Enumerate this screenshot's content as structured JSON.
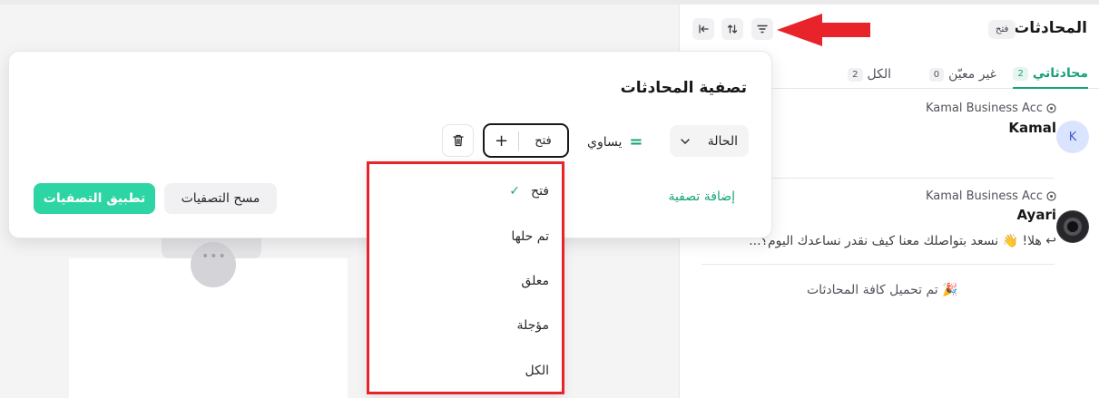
{
  "sidebar": {
    "title": "المحادثات",
    "status_pill": "فتح",
    "icons": [
      "filter-icon",
      "sort-icon",
      "collapse-icon"
    ],
    "tabs": [
      {
        "label": "محادثاتي",
        "count": "2"
      },
      {
        "label": "غير معيّن",
        "count": "0"
      },
      {
        "label": "الكل",
        "count": "2"
      }
    ],
    "conversations": [
      {
        "inbox": "Kamal Business Acc",
        "name": "Kamal",
        "avatar": "K",
        "message": ""
      },
      {
        "inbox": "Kamal Business Acc",
        "name": "Ayari",
        "avatar": "",
        "message": "هلا! 👋 نسعد بتواصلك معنا كيف نقدر نساعدك اليوم؟..."
      }
    ],
    "loaded_note": "🎉 تم تحميل كافة المحادثات"
  },
  "filter": {
    "title": "تصفية المحادثات",
    "attribute": "الحالة",
    "operator_symbol": "=",
    "operator": "يساوي",
    "value": "فتح",
    "add_filter": "إضافة تصفية",
    "apply": "تطبيق التصفيات",
    "clear": "مسح التصفيات"
  },
  "dropdown": {
    "options": [
      "فتح",
      "تم حلها",
      "معلق",
      "مؤجلة",
      "الكل"
    ],
    "selected": "فتح"
  },
  "colors": {
    "accent": "#16a37a",
    "apply_button": "#2dd4a4",
    "annotation": "#e8232a"
  }
}
